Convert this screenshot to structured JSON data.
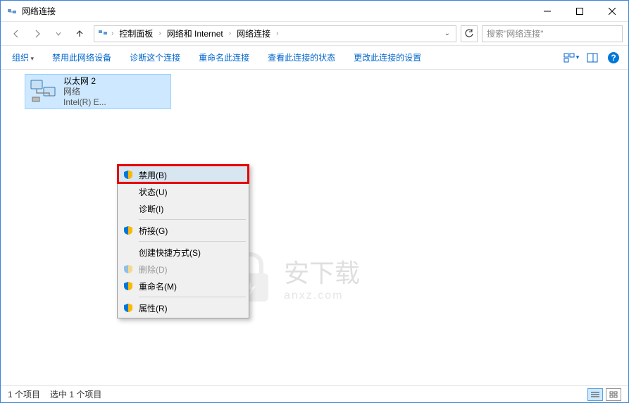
{
  "window": {
    "title": "网络连接"
  },
  "nav": {
    "crumbs": [
      "控制面板",
      "网络和 Internet",
      "网络连接"
    ],
    "search_placeholder": "搜索\"网络连接\""
  },
  "toolbar": {
    "organize": "组织",
    "disable": "禁用此网络设备",
    "diagnose": "诊断这个连接",
    "rename": "重命名此连接",
    "status": "查看此连接的状态",
    "change": "更改此连接的设置"
  },
  "item": {
    "name": "以太网 2",
    "network": "网络",
    "adapter": "Intel(R) E..."
  },
  "context_menu": {
    "disable": "禁用(B)",
    "status": "状态(U)",
    "diagnose": "诊断(I)",
    "bridge": "桥接(G)",
    "shortcut": "创建快捷方式(S)",
    "delete": "删除(D)",
    "rename": "重命名(M)",
    "properties": "属性(R)"
  },
  "watermark": {
    "text": "安下载",
    "sub": "anxz.com"
  },
  "status": {
    "count": "1 个项目",
    "selected": "选中 1 个项目"
  }
}
